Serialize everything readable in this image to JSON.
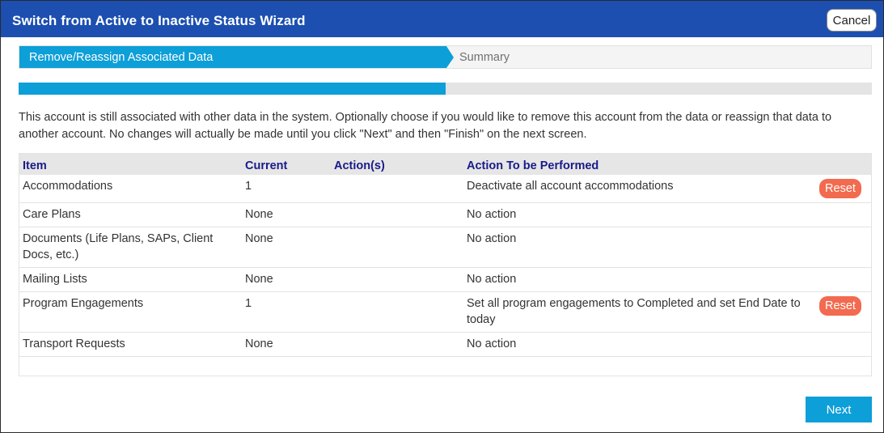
{
  "dialog": {
    "title": "Switch from Active to Inactive Status Wizard",
    "cancel_label": "Cancel",
    "next_label": "Next"
  },
  "steps": {
    "active": "Remove/Reassign Associated Data",
    "next": "Summary"
  },
  "progress": {
    "fraction": 0.5
  },
  "info_text": "This account is still associated with other data in the system. Optionally choose if you would like to remove this account from the data or reassign that data to another account. No changes will actually be made until you click \"Next\" and then \"Finish\" on the next screen.",
  "table": {
    "headers": {
      "item": "Item",
      "current": "Current",
      "actions": "Action(s)",
      "perform": "Action To be Performed"
    },
    "rows": [
      {
        "item": "Accommodations",
        "current": "1",
        "actions": "",
        "perform": "Deactivate all account accommodations",
        "reset": "Reset"
      },
      {
        "item": "Care Plans",
        "current": "None",
        "actions": "",
        "perform": "No action",
        "reset": ""
      },
      {
        "item": "Documents (Life Plans, SAPs, Client Docs, etc.)",
        "current": "None",
        "actions": "",
        "perform": "No action",
        "reset": ""
      },
      {
        "item": "Mailing Lists",
        "current": "None",
        "actions": "",
        "perform": "No action",
        "reset": ""
      },
      {
        "item": "Program Engagements",
        "current": "1",
        "actions": "",
        "perform": "Set all program engagements to Completed and set End Date to today",
        "reset": "Reset"
      },
      {
        "item": "Transport Requests",
        "current": "None",
        "actions": "",
        "perform": "No action",
        "reset": ""
      }
    ]
  },
  "colors": {
    "titlebar": "#1c4fb0",
    "accent": "#0d9fd8",
    "reset": "#f26a4f",
    "header_text": "#1a1a8a"
  }
}
